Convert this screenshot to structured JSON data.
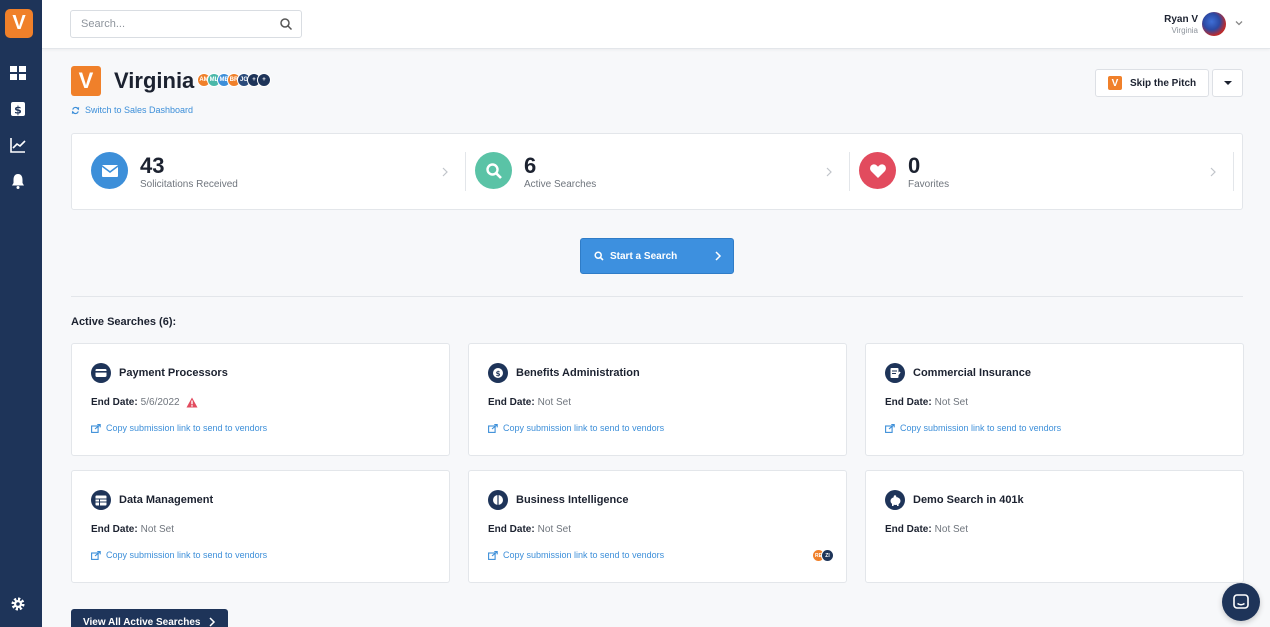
{
  "app": {
    "logo_letter": "V",
    "brand_color": "#f0802a",
    "sidebar_color": "#1e3459"
  },
  "sidebar": {
    "items": [
      {
        "name": "dashboard-icon"
      },
      {
        "name": "dollar-icon"
      },
      {
        "name": "chart-icon"
      },
      {
        "name": "bell-icon"
      },
      {
        "name": "gear-icon"
      }
    ]
  },
  "search": {
    "placeholder": "Search..."
  },
  "user": {
    "name": "Ryan V",
    "location": "Virginia"
  },
  "header": {
    "title": "Virginia",
    "switch_label": "Switch to Sales Dashboard",
    "skip_label": "Skip the Pitch",
    "badges": [
      {
        "initials": "AM",
        "color": "#f0802a"
      },
      {
        "initials": "ML",
        "color": "#4bb8a9"
      },
      {
        "initials": "ME",
        "color": "#3d8fd9"
      },
      {
        "initials": "BR",
        "color": "#f0802a"
      },
      {
        "initials": "JG",
        "color": "#2a4a7a"
      },
      {
        "initials": "+",
        "color": "#1e3459"
      },
      {
        "initials": "+",
        "color": "#1e3459"
      }
    ]
  },
  "stats": [
    {
      "value": "43",
      "label": "Solicitations Received",
      "icon": "envelope-icon",
      "color": "#3d8fd9"
    },
    {
      "value": "6",
      "label": "Active Searches",
      "icon": "search-icon",
      "color": "#5ac3a6"
    },
    {
      "value": "0",
      "label": "Favorites",
      "icon": "heart-icon",
      "color": "#e24b5e"
    }
  ],
  "cta": {
    "label": "Start a Search"
  },
  "active": {
    "title": "Active Searches (6):",
    "end_label": "End Date:",
    "copy_label": "Copy submission link to send to vendors",
    "cards": [
      {
        "name": "Payment Processors",
        "end": "5/6/2022",
        "icon": "credit-card-icon",
        "warn": true,
        "show_copy": true
      },
      {
        "name": "Benefits Administration",
        "end": "Not Set",
        "icon": "benefits-icon",
        "warn": false,
        "show_copy": true
      },
      {
        "name": "Commercial Insurance",
        "end": "Not Set",
        "icon": "insurance-icon",
        "warn": false,
        "show_copy": true
      },
      {
        "name": "Data Management",
        "end": "Not Set",
        "icon": "database-icon",
        "warn": false,
        "show_copy": true
      },
      {
        "name": "Business Intelligence",
        "end": "Not Set",
        "icon": "brain-icon",
        "warn": false,
        "show_copy": true,
        "badges": [
          {
            "initials": "RE",
            "color": "#f0802a"
          },
          {
            "initials": "ZI",
            "color": "#1e3459"
          }
        ]
      },
      {
        "name": "Demo Search in 401k",
        "end": "Not Set",
        "icon": "piggy-bank-icon",
        "warn": false,
        "show_copy": false
      }
    ],
    "view_all_label": "View All Active Searches"
  }
}
